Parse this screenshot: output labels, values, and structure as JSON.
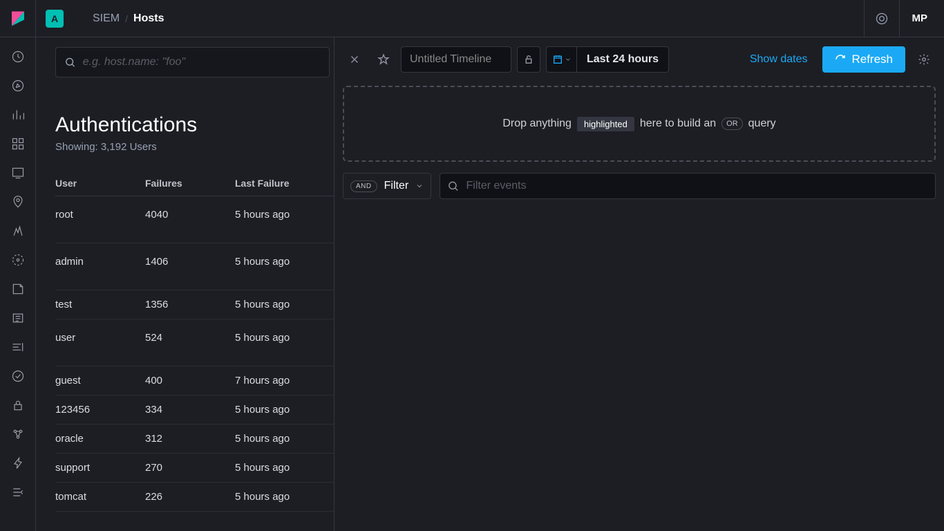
{
  "header": {
    "space_letter": "A",
    "breadcrumbs": [
      "SIEM",
      "Hosts"
    ],
    "user_initials": "MP"
  },
  "search": {
    "placeholder": "e.g. host.name: \"foo\""
  },
  "auth": {
    "title": "Authentications",
    "subtitle": "Showing: 3,192 Users",
    "columns": {
      "user": "User",
      "failures": "Failures",
      "last_failure": "Last Failure"
    },
    "rows": [
      {
        "user": "root",
        "failures": "4040",
        "last_failure": "5 hours ago"
      },
      {
        "user": "admin",
        "failures": "1406",
        "last_failure": "5 hours ago"
      },
      {
        "user": "test",
        "failures": "1356",
        "last_failure": "5 hours ago"
      },
      {
        "user": "user",
        "failures": "524",
        "last_failure": "5 hours ago"
      },
      {
        "user": "guest",
        "failures": "400",
        "last_failure": "7 hours ago"
      },
      {
        "user": "123456",
        "failures": "334",
        "last_failure": "5 hours ago"
      },
      {
        "user": "oracle",
        "failures": "312",
        "last_failure": "5 hours ago"
      },
      {
        "user": "support",
        "failures": "270",
        "last_failure": "5 hours ago"
      },
      {
        "user": "tomcat",
        "failures": "226",
        "last_failure": "5 hours ago"
      }
    ]
  },
  "timeline": {
    "title_placeholder": "Untitled Timeline",
    "date_range": "Last 24 hours",
    "show_dates": "Show dates",
    "refresh": "Refresh",
    "drop_pre": "Drop anything",
    "drop_hl": "highlighted",
    "drop_mid": "here to build an",
    "drop_or": "OR",
    "drop_post": "query",
    "and_label": "AND",
    "filter_label": "Filter",
    "events_placeholder": "Filter events"
  }
}
